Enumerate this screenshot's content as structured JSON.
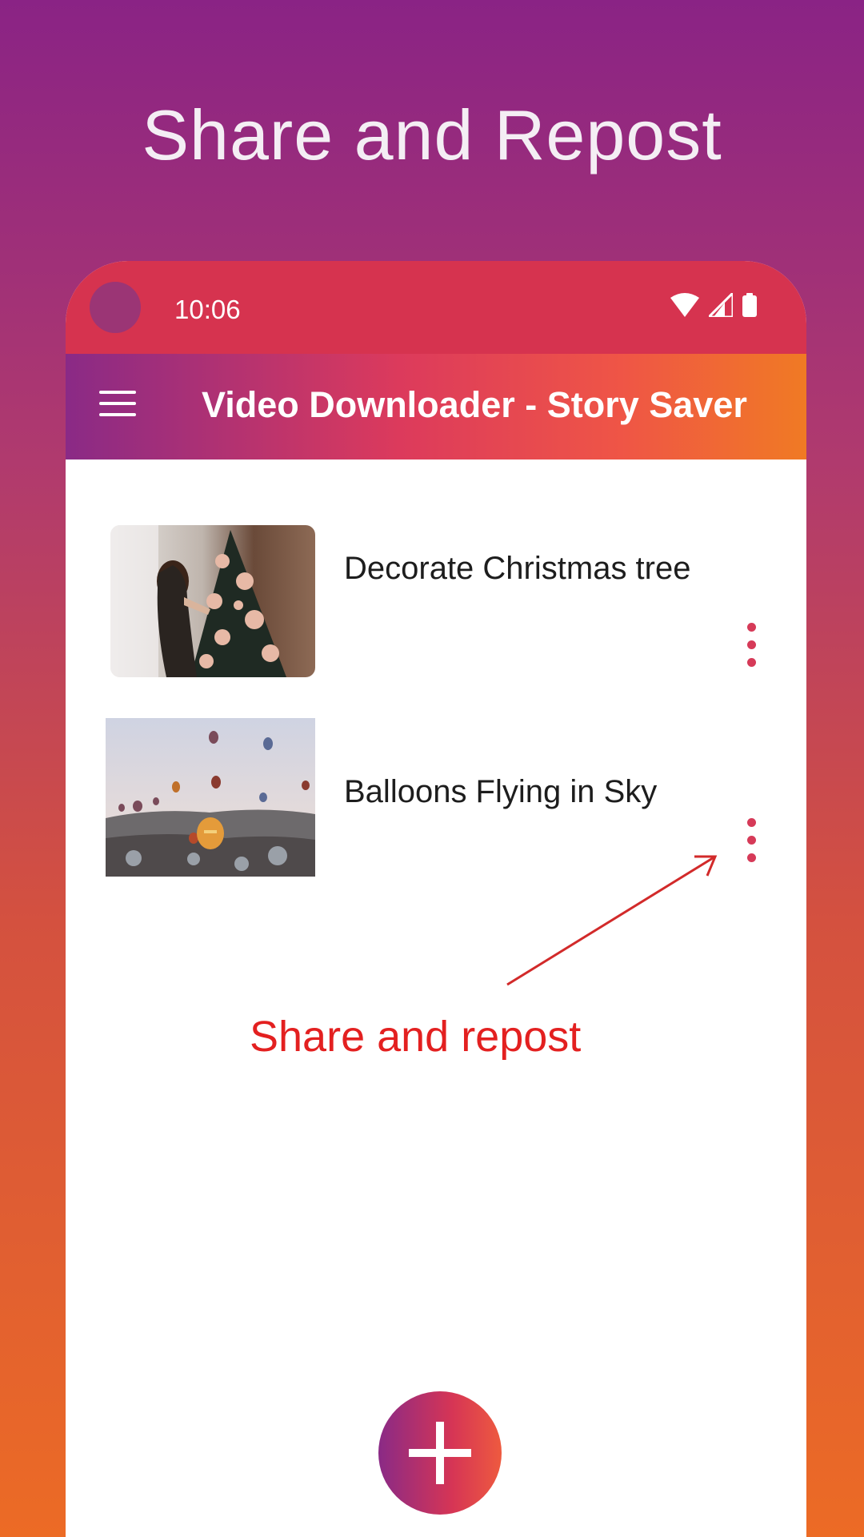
{
  "headline": "Share and Repost",
  "status_bar": {
    "time": "10:06",
    "icons": [
      "wifi-icon",
      "cellular-signal-icon",
      "battery-icon"
    ]
  },
  "app_bar": {
    "menu_icon": "hamburger-menu-icon",
    "title": "Video Downloader - Story Saver"
  },
  "items": [
    {
      "title": "Decorate Christmas tree",
      "thumbnail": "christmas-tree-photo",
      "menu_icon": "more-vert-icon"
    },
    {
      "title": "Balloons Flying in Sky",
      "thumbnail": "hot-air-balloons-photo",
      "menu_icon": "more-vert-icon"
    }
  ],
  "annotation": {
    "text": "Share and repost",
    "color": "#e32020"
  },
  "fab": {
    "icon": "plus-icon"
  },
  "colors": {
    "status_bar": "#d6334f",
    "accent": "#d63a58",
    "app_bar_gradient": [
      "#8a2a86",
      "#dc3a5c",
      "#f07a24"
    ]
  }
}
